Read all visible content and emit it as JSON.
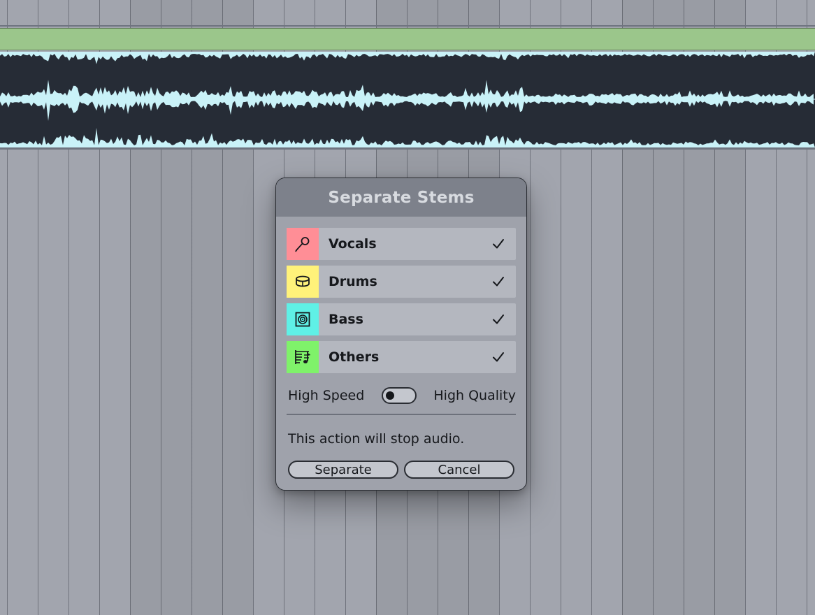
{
  "dialog": {
    "title": "Separate Stems",
    "stems": [
      {
        "label": "Vocals",
        "icon": "microphone-icon",
        "color": "#ff8e96",
        "checked": true
      },
      {
        "label": "Drums",
        "icon": "drum-icon",
        "color": "#fff27a",
        "checked": true
      },
      {
        "label": "Bass",
        "icon": "speaker-icon",
        "color": "#5ff0e6",
        "checked": true
      },
      {
        "label": "Others",
        "icon": "sheet-music-icon",
        "color": "#7ff26a",
        "checked": true
      }
    ],
    "mode": {
      "left_label": "High Speed",
      "right_label": "High Quality",
      "selected": "High Speed"
    },
    "message": "This action will stop audio.",
    "separate_label": "Separate",
    "cancel_label": "Cancel"
  },
  "colors": {
    "clip_header": "#9bc68b",
    "waveform": "#c9f2f8",
    "waveform_background": "#262c36",
    "dialog_background": "#9fa2ab",
    "dialog_titlebar": "#7d818b"
  }
}
